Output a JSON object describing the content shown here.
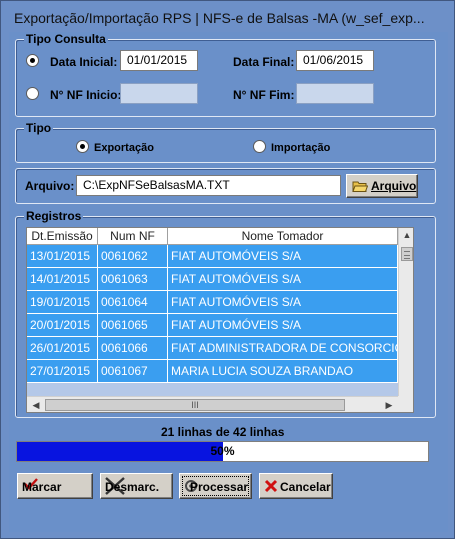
{
  "window": {
    "title": "Exportação/Importação RPS  |  NFS-e de Balsas -MA (w_sef_exp..."
  },
  "tipo_consulta": {
    "legend": "Tipo Consulta",
    "data_inicial_label": "Data Inicial:",
    "data_inicial_value": "01/01/2015",
    "data_final_label": "Data Final:",
    "data_final_value": "01/06/2015",
    "nf_inicio_label": "N° NF Inicio:",
    "nf_inicio_value": "",
    "nf_fim_label": "N° NF Fim:",
    "nf_fim_value": "",
    "selected": "Data Inicial"
  },
  "tipo": {
    "legend": "Tipo",
    "exportacao_label": "Exportação",
    "importacao_label": "Importação",
    "selected": "Exportação"
  },
  "arquivo": {
    "label": "Arquivo:",
    "value": "C:\\ExpNFSeBalsasMA.TXT",
    "button_label": "Arquivo",
    "button_icon": "folder-open-icon"
  },
  "registros": {
    "legend": "Registros",
    "columns": [
      "Dt.Emissão",
      "Num NF",
      "Nome Tomador"
    ],
    "rows": [
      [
        "13/01/2015",
        "0061062",
        "FIAT AUTOMÓVEIS S/A"
      ],
      [
        "14/01/2015",
        "0061063",
        "FIAT AUTOMÓVEIS S/A"
      ],
      [
        "19/01/2015",
        "0061064",
        "FIAT AUTOMÓVEIS S/A"
      ],
      [
        "20/01/2015",
        "0061065",
        "FIAT AUTOMÓVEIS S/A"
      ],
      [
        "26/01/2015",
        "0061066",
        "FIAT ADMINISTRADORA DE CONSORCIOS"
      ],
      [
        "27/01/2015",
        "0061067",
        "MARIA LUCIA SOUZA BRANDAO"
      ]
    ],
    "row_highlight_color": "#3a9ef0",
    "scroll_thumb_glyph": "III"
  },
  "status": {
    "lines_text": "21 linhas de 42 linhas",
    "progress_value": 50,
    "progress_label": "50%",
    "progress_color": "#0814e0"
  },
  "buttons": {
    "marcar": "Marcar",
    "desmarcar": "Desmarc.",
    "processar": "Processar",
    "cancelar": "Cancelar"
  }
}
